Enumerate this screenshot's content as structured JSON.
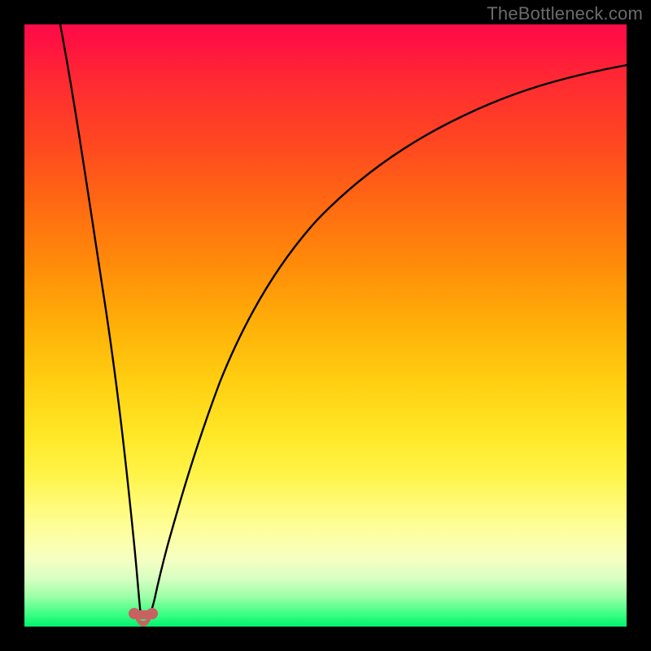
{
  "watermark": "TheBottleneck.com",
  "chart_data": {
    "type": "line",
    "title": "",
    "xlabel": "",
    "ylabel": "",
    "xlim": [
      0,
      100
    ],
    "ylim": [
      0,
      100
    ],
    "series": [
      {
        "name": "bottleneck-curve",
        "x": [
          6,
          8,
          10,
          12,
          14,
          16,
          17,
          18,
          19,
          20,
          21,
          22,
          24,
          26,
          30,
          35,
          40,
          45,
          50,
          55,
          60,
          65,
          70,
          75,
          80,
          85,
          90,
          95,
          100
        ],
        "values": [
          100,
          85,
          70,
          55,
          40,
          25,
          15,
          6,
          1,
          0,
          1,
          5,
          16,
          28,
          45,
          58,
          66,
          72,
          76,
          79,
          82,
          84,
          86,
          87.5,
          89,
          90,
          91,
          91.8,
          92.5
        ]
      }
    ],
    "marker": {
      "name": "optimal-zone",
      "x_range": [
        18.2,
        21.2
      ],
      "y": 1.5,
      "color": "#c86262"
    },
    "background_gradient": {
      "top": "#ff0b47",
      "mid": "#ffe726",
      "bottom": "#00f26f"
    }
  }
}
